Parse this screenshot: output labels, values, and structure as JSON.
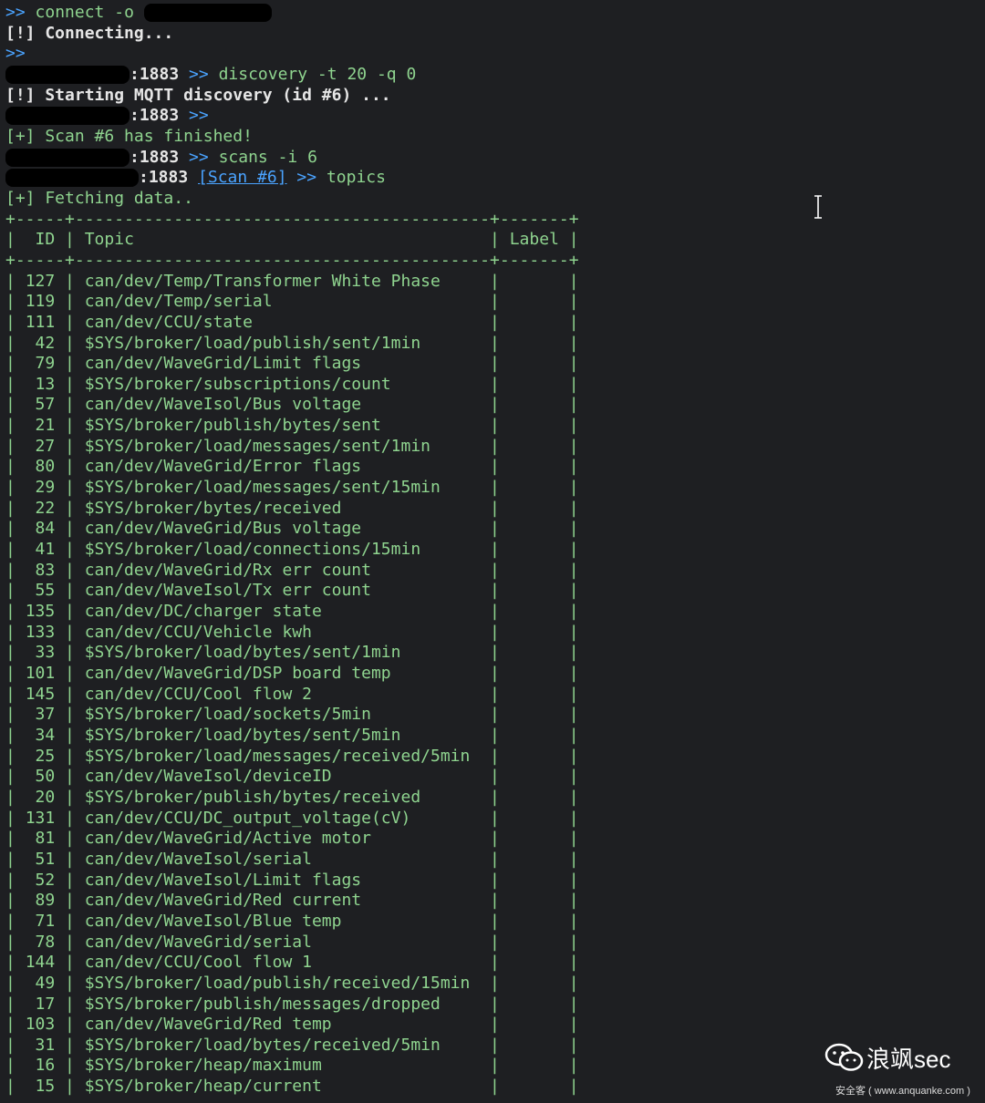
{
  "session": {
    "prompt_symbol": ">>",
    "connect_cmd": "connect -o",
    "connecting_msg": "[!] Connecting...",
    "host_port": ":1883",
    "discovery_cmd": "discovery -t 20 -q 0",
    "discovery_msg": "[!] Starting MQTT discovery (id #6) ...",
    "scan_finished_prefix": "[+] Scan #6 has finished!",
    "scans_cmd": "scans -i 6",
    "scan_context": "[Scan #6]",
    "topics_cmd": "topics",
    "fetching_msg": "[+] Fetching data.."
  },
  "table": {
    "border_top": "+-----+------------------------------------------+-------+",
    "header_id": "ID",
    "header_topic": "Topic",
    "header_label": "Label",
    "border_mid": "+-----+------------------------------------------+-------+",
    "rows": [
      {
        "id": "127",
        "topic": "can/dev/Temp/Transformer White Phase"
      },
      {
        "id": "119",
        "topic": "can/dev/Temp/serial"
      },
      {
        "id": "111",
        "topic": "can/dev/CCU/state"
      },
      {
        "id": "42",
        "topic": "$SYS/broker/load/publish/sent/1min"
      },
      {
        "id": "79",
        "topic": "can/dev/WaveGrid/Limit flags"
      },
      {
        "id": "13",
        "topic": "$SYS/broker/subscriptions/count"
      },
      {
        "id": "57",
        "topic": "can/dev/WaveIsol/Bus voltage"
      },
      {
        "id": "21",
        "topic": "$SYS/broker/publish/bytes/sent"
      },
      {
        "id": "27",
        "topic": "$SYS/broker/load/messages/sent/1min"
      },
      {
        "id": "80",
        "topic": "can/dev/WaveGrid/Error flags"
      },
      {
        "id": "29",
        "topic": "$SYS/broker/load/messages/sent/15min"
      },
      {
        "id": "22",
        "topic": "$SYS/broker/bytes/received"
      },
      {
        "id": "84",
        "topic": "can/dev/WaveGrid/Bus voltage"
      },
      {
        "id": "41",
        "topic": "$SYS/broker/load/connections/15min"
      },
      {
        "id": "83",
        "topic": "can/dev/WaveGrid/Rx err count"
      },
      {
        "id": "55",
        "topic": "can/dev/WaveIsol/Tx err count"
      },
      {
        "id": "135",
        "topic": "can/dev/DC/charger state"
      },
      {
        "id": "133",
        "topic": "can/dev/CCU/Vehicle kwh"
      },
      {
        "id": "33",
        "topic": "$SYS/broker/load/bytes/sent/1min"
      },
      {
        "id": "101",
        "topic": "can/dev/WaveGrid/DSP board temp"
      },
      {
        "id": "145",
        "topic": "can/dev/CCU/Cool flow 2"
      },
      {
        "id": "37",
        "topic": "$SYS/broker/load/sockets/5min"
      },
      {
        "id": "34",
        "topic": "$SYS/broker/load/bytes/sent/5min"
      },
      {
        "id": "25",
        "topic": "$SYS/broker/load/messages/received/5min"
      },
      {
        "id": "50",
        "topic": "can/dev/WaveIsol/deviceID"
      },
      {
        "id": "20",
        "topic": "$SYS/broker/publish/bytes/received"
      },
      {
        "id": "131",
        "topic": "can/dev/CCU/DC_output_voltage(cV)"
      },
      {
        "id": "81",
        "topic": "can/dev/WaveGrid/Active motor"
      },
      {
        "id": "51",
        "topic": "can/dev/WaveIsol/serial"
      },
      {
        "id": "52",
        "topic": "can/dev/WaveIsol/Limit flags"
      },
      {
        "id": "89",
        "topic": "can/dev/WaveGrid/Red current"
      },
      {
        "id": "71",
        "topic": "can/dev/WaveIsol/Blue temp"
      },
      {
        "id": "78",
        "topic": "can/dev/WaveGrid/serial"
      },
      {
        "id": "144",
        "topic": "can/dev/CCU/Cool flow 1"
      },
      {
        "id": "49",
        "topic": "$SYS/broker/load/publish/received/15min"
      },
      {
        "id": "17",
        "topic": "$SYS/broker/publish/messages/dropped"
      },
      {
        "id": "103",
        "topic": "can/dev/WaveGrid/Red temp"
      },
      {
        "id": "31",
        "topic": "$SYS/broker/load/bytes/received/5min"
      },
      {
        "id": "16",
        "topic": "$SYS/broker/heap/maximum"
      },
      {
        "id": "15",
        "topic": "$SYS/broker/heap/current"
      }
    ]
  },
  "watermark": {
    "title": "浪飒sec",
    "subtitle": "安全客 ( www.anquanke.com )",
    "icon": "wechat-icon"
  },
  "colors": {
    "background": "#1e1f22",
    "prompt": "#4aa3ff",
    "output_green": "#8fd48f",
    "text": "#e6e6e6"
  }
}
